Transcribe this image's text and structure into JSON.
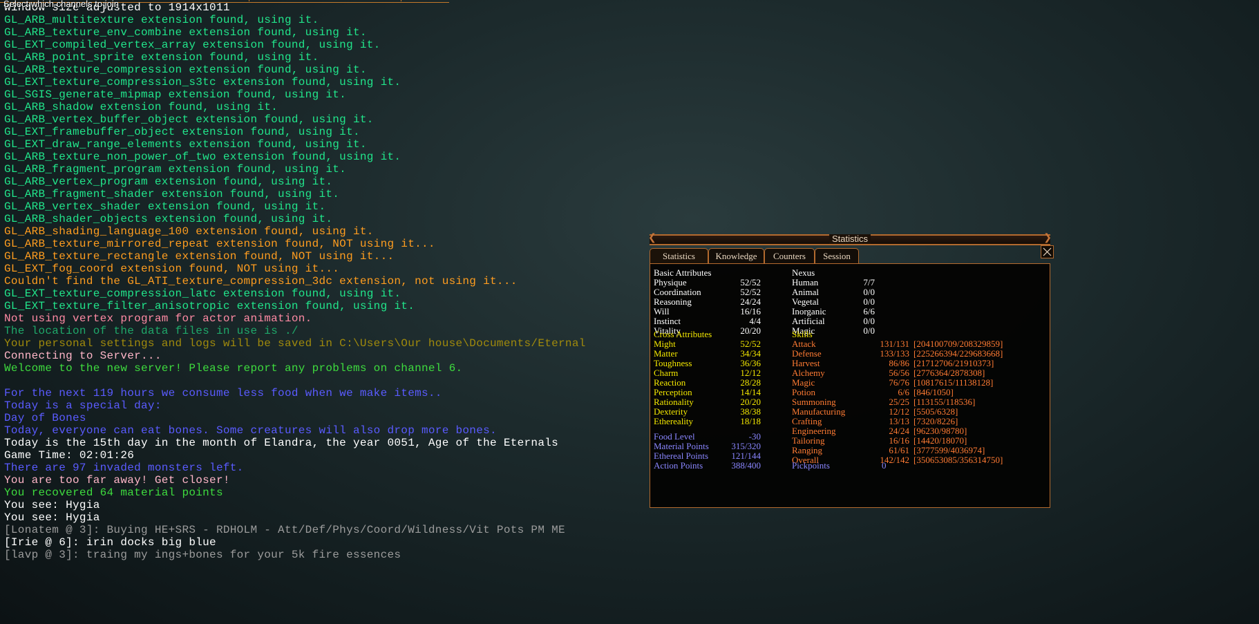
{
  "top_hint": "Select which channels to join",
  "colors": {
    "green": "#21e58b",
    "orange": "#ff9d1f",
    "pink": "#ff8aa4",
    "teal": "#1fd68a",
    "lightgreen": "#3edc3e",
    "blue": "#5a5bff",
    "white": "#ffffff",
    "gray": "#9c9c9c"
  },
  "console": [
    {
      "text": "Window size adjusted to 1914x1011",
      "color": "#ffffff"
    },
    {
      "text": "GL_ARB_multitexture extension found, using it.",
      "color": "#21e58b"
    },
    {
      "text": "GL_ARB_texture_env_combine extension found, using it.",
      "color": "#21e58b"
    },
    {
      "text": "GL_EXT_compiled_vertex_array extension found, using it.",
      "color": "#21e58b"
    },
    {
      "text": "GL_ARB_point_sprite extension found, using it.",
      "color": "#21e58b"
    },
    {
      "text": "GL_ARB_texture_compression extension found, using it.",
      "color": "#21e58b"
    },
    {
      "text": "GL_EXT_texture_compression_s3tc extension found, using it.",
      "color": "#21e58b"
    },
    {
      "text": "GL_SGIS_generate_mipmap extension found, using it.",
      "color": "#21e58b"
    },
    {
      "text": "GL_ARB_shadow extension found, using it.",
      "color": "#21e58b"
    },
    {
      "text": "GL_ARB_vertex_buffer_object extension found, using it.",
      "color": "#21e58b"
    },
    {
      "text": "GL_EXT_framebuffer_object extension found, using it.",
      "color": "#21e58b"
    },
    {
      "text": "GL_EXT_draw_range_elements extension found, using it.",
      "color": "#21e58b"
    },
    {
      "text": "GL_ARB_texture_non_power_of_two extension found, using it.",
      "color": "#21e58b"
    },
    {
      "text": "GL_ARB_fragment_program extension found, using it.",
      "color": "#21e58b"
    },
    {
      "text": "GL_ARB_vertex_program extension found, using it.",
      "color": "#21e58b"
    },
    {
      "text": "GL_ARB_fragment_shader extension found, using it.",
      "color": "#21e58b"
    },
    {
      "text": "GL_ARB_vertex_shader extension found, using it.",
      "color": "#21e58b"
    },
    {
      "text": "GL_ARB_shader_objects extension found, using it.",
      "color": "#21e58b"
    },
    {
      "text": "GL_ARB_shading_language_100 extension found, using it.",
      "color": "#ff9d1f"
    },
    {
      "text": "GL_ARB_texture_mirrored_repeat extension found, NOT using it...",
      "color": "#ff9d1f"
    },
    {
      "text": "GL_ARB_texture_rectangle extension found, NOT using it...",
      "color": "#ff9d1f"
    },
    {
      "text": "GL_EXT_fog_coord extension found, NOT using it...",
      "color": "#ff9d1f"
    },
    {
      "text": "Couldn't find the GL_ATI_texture_compression_3dc extension, not using it...",
      "color": "#ff9d1f"
    },
    {
      "text": "GL_EXT_texture_compression_latc extension found, using it.",
      "color": "#21e58b"
    },
    {
      "text": "GL_EXT_texture_filter_anisotropic extension found, using it.",
      "color": "#21e58b"
    },
    {
      "text": "Not using vertex program for actor animation.",
      "color": "#ff8aa4"
    },
    {
      "text": "The location of the data files in use is ./",
      "color": "#1fa86a"
    },
    {
      "text": "Your personal settings and logs will be saved in C:\\Users\\Our house\\Documents/Eternal",
      "color": "#a08a0c"
    },
    {
      "text": "Connecting to Server...",
      "color": "#ffb6c8"
    },
    {
      "text": "Welcome to the new server! Please report any problems on channel 6.",
      "color": "#3edc3e"
    },
    {
      "text": "",
      "color": "#ffffff"
    },
    {
      "text": "For the next 119 hours we consume less food when we make items..",
      "color": "#5a5bff"
    },
    {
      "text": "Today is a special day:",
      "color": "#5a5bff"
    },
    {
      "text": "Day of Bones",
      "color": "#5a5bff"
    },
    {
      "text": "Today, everyone can eat bones. Some creatures will also drop more bones.",
      "color": "#5a5bff"
    },
    {
      "text": "Today is the 15th day in the month of Elandra, the year 0051, Age of the Eternals",
      "color": "#ffffff"
    },
    {
      "text": "Game Time: 02:01:26",
      "color": "#ffffff"
    },
    {
      "text": "There are 97 invaded monsters left.",
      "color": "#5a5bff"
    },
    {
      "text": "You are too far away! Get closer!",
      "color": "#ffb6c8"
    },
    {
      "text": "You recovered 64 material points",
      "color": "#3edc3e"
    },
    {
      "text": "You see: Hygia",
      "color": "#ffffff"
    },
    {
      "text": "You see: Hygia",
      "color": "#ffffff"
    },
    {
      "text": "[Lonatem @ 3]: Buying HE+SRS - RDHOLM - Att/Def/Phys/Coord/Wildness/Vit Pots PM ME",
      "color": "#9c9c9c"
    },
    {
      "text": "[Irie @ 6]: irin docks big blue",
      "color": "#ffffff"
    },
    {
      "text": "[lavp @ 3]: traing my ings+bones for your 5k fire essences",
      "color": "#9c9c9c"
    }
  ],
  "stats_window": {
    "title": "Statistics",
    "tabs": [
      "Statistics",
      "Knowledge",
      "Counters",
      "Session"
    ],
    "basic_attributes": {
      "header": "Basic Attributes",
      "rows": [
        {
          "label": "Physique",
          "value": "52/52"
        },
        {
          "label": "Coordination",
          "value": "52/52"
        },
        {
          "label": "Reasoning",
          "value": "24/24"
        },
        {
          "label": "Will",
          "value": "16/16"
        },
        {
          "label": "Instinct",
          "value": "4/4"
        },
        {
          "label": "Vitality",
          "value": "20/20"
        }
      ]
    },
    "nexus": {
      "header": "Nexus",
      "rows": [
        {
          "label": "Human",
          "value": "7/7"
        },
        {
          "label": "Animal",
          "value": "0/0"
        },
        {
          "label": "Vegetal",
          "value": "0/0"
        },
        {
          "label": "Inorganic",
          "value": "6/6"
        },
        {
          "label": "Artificial",
          "value": "0/0"
        },
        {
          "label": "Magic",
          "value": "0/0"
        }
      ]
    },
    "cross_attributes": {
      "header": "Cross Attributes",
      "rows": [
        {
          "label": "Might",
          "value": "52/52"
        },
        {
          "label": "Matter",
          "value": "34/34"
        },
        {
          "label": "Toughness",
          "value": "36/36"
        },
        {
          "label": "Charm",
          "value": "12/12"
        },
        {
          "label": "Reaction",
          "value": "28/28"
        },
        {
          "label": "Perception",
          "value": "14/14"
        },
        {
          "label": "Rationality",
          "value": "20/20"
        },
        {
          "label": "Dexterity",
          "value": "38/38"
        },
        {
          "label": "Ethereality",
          "value": "18/18"
        }
      ]
    },
    "skills": {
      "header": "Skills",
      "rows": [
        {
          "label": "Attack",
          "value": "131/131",
          "exp": "[204100709/208329859]"
        },
        {
          "label": "Defense",
          "value": "133/133",
          "exp": "[225266394/229683668]"
        },
        {
          "label": "Harvest",
          "value": "86/86",
          "exp": "[21712706/21910373]"
        },
        {
          "label": "Alchemy",
          "value": "56/56",
          "exp": "[2776364/2878308]"
        },
        {
          "label": "Magic",
          "value": "76/76",
          "exp": "[10817615/11138128]"
        },
        {
          "label": "Potion",
          "value": "6/6",
          "exp": "[846/1050]"
        },
        {
          "label": "Summoning",
          "value": "25/25",
          "exp": "[113155/118536]"
        },
        {
          "label": "Manufacturing",
          "value": "12/12",
          "exp": "[5505/6328]"
        },
        {
          "label": "Crafting",
          "value": "13/13",
          "exp": "[7320/8226]"
        },
        {
          "label": "Engineering",
          "value": "24/24",
          "exp": "[96230/98780]"
        },
        {
          "label": "Tailoring",
          "value": "16/16",
          "exp": "[14420/18070]"
        },
        {
          "label": "Ranging",
          "value": "61/61",
          "exp": "[3777599/4036974]"
        },
        {
          "label": "Overall",
          "value": "142/142",
          "exp": "[350653085/356314750]"
        }
      ]
    },
    "points": [
      {
        "label": "Food Level",
        "value": "-30"
      },
      {
        "label": "Material Points",
        "value": "315/320"
      },
      {
        "label": "Ethereal Points",
        "value": "121/144"
      },
      {
        "label": "Action Points",
        "value": "388/400"
      }
    ],
    "pickpoints": {
      "label": "Pickpoints",
      "value": "0"
    }
  }
}
